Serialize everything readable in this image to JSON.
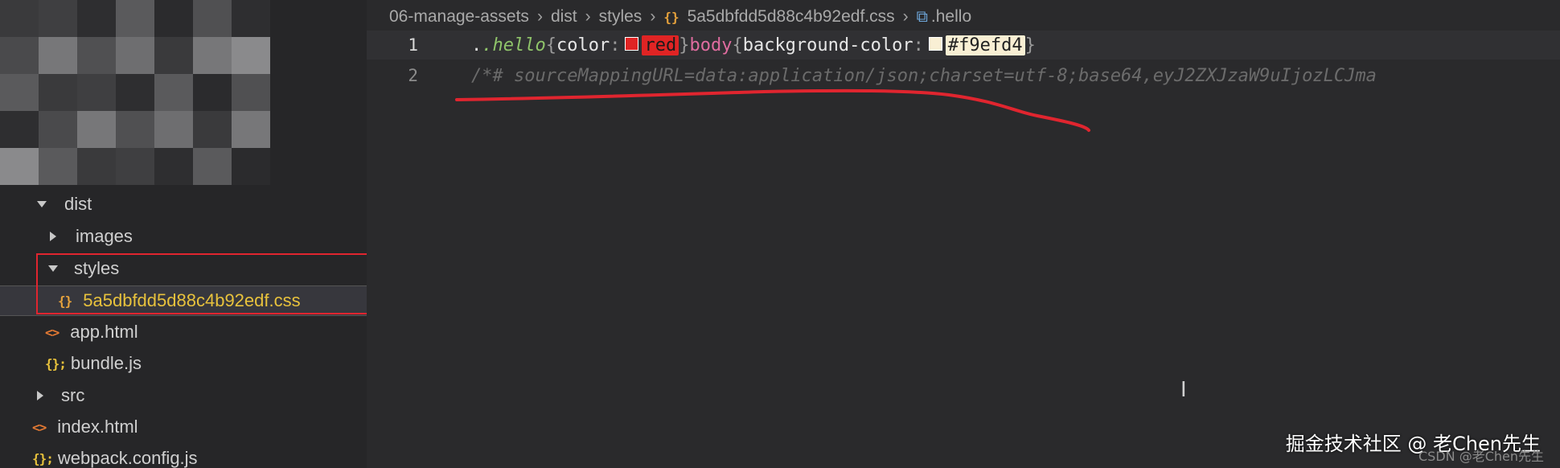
{
  "sidebar": {
    "tree": [
      {
        "label": "dist",
        "type": "folder-open",
        "indent": 0
      },
      {
        "label": "images",
        "type": "folder-closed",
        "indent": 1
      },
      {
        "label": "styles",
        "type": "folder-open",
        "indent": 1
      },
      {
        "label": "5a5dbfdd5d88c4b92edf.css",
        "type": "css",
        "indent": 2,
        "selected": true
      },
      {
        "label": "app.html",
        "type": "html",
        "indent": 1
      },
      {
        "label": "bundle.js",
        "type": "js",
        "indent": 1
      },
      {
        "label": "src",
        "type": "folder-closed",
        "indent": 0
      },
      {
        "label": "index.html",
        "type": "html",
        "indent": 0
      },
      {
        "label": "webpack.config.js",
        "type": "js",
        "indent": 0
      }
    ]
  },
  "breadcrumb": {
    "items": [
      "06-manage-assets",
      "dist",
      "styles",
      "5a5dbfdd5d88c4b92edf.css",
      ".hello"
    ]
  },
  "editor": {
    "lines": [
      {
        "number": "1",
        "sel1": ".hello",
        "prop1": "color",
        "val1": "red",
        "sel2": "body",
        "prop2": "background-color",
        "val2": "#f9efd4"
      },
      {
        "number": "2",
        "comment": "/*# sourceMappingURL=data:application/json;charset=utf-8;base64,eyJ2ZXJzaW9uIjozLCJma"
      }
    ],
    "swatch_colors": {
      "red": "#e02424",
      "cream": "#f9efd4"
    }
  },
  "watermark": {
    "main": "掘金技术社区 @ 老Chen先生",
    "sub": "CSDN @老Chen先生"
  },
  "annotation_color": "#e0252f"
}
